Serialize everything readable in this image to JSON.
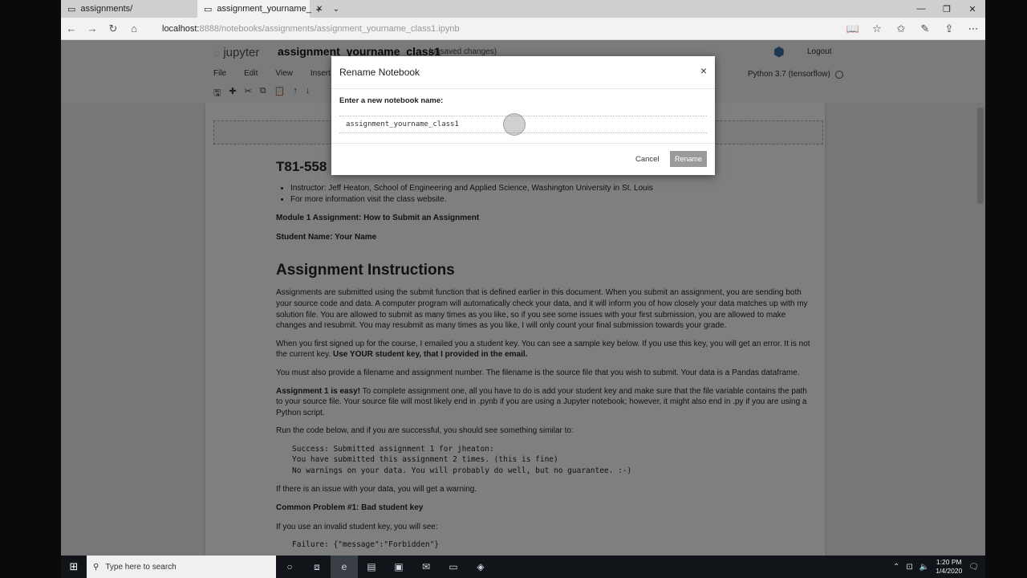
{
  "browser": {
    "tabs": [
      {
        "title": "assignments/",
        "active": false
      },
      {
        "title": "assignment_yourname_",
        "active": true
      }
    ],
    "new_tab": "+",
    "tab_menu": "⌄",
    "url_host": "localhost:",
    "url_rest": "8888/notebooks/assignments/assignment_yourname_class1.ipynb"
  },
  "jupyter": {
    "logo_text": "jupyter",
    "notebook_title": "assignment_yourname_class1",
    "save_status": "(unsaved changes)",
    "logout_label": "Logout",
    "menu": [
      "File",
      "Edit",
      "View",
      "Insert"
    ],
    "kernel_label": "Python 3.7 (tensorflow)",
    "toolbar_icons": [
      "save-icon",
      "plus-icon",
      "cut-icon",
      "copy-icon",
      "paste-icon",
      "arrow-up-icon",
      "arrow-down-icon"
    ]
  },
  "notebook": {
    "course_title": "T81-558",
    "bullets": [
      "Instructor: Jeff Heaton, School of Engineering and Applied Science, Washington University in St. Louis",
      "For more information visit the class website."
    ],
    "module_line": "Module 1 Assignment: How to Submit an Assignment",
    "student_line": "Student Name: Your Name",
    "h2": "Assignment Instructions",
    "p1": "Assignments are submitted using the submit function that is defined earlier in this document. When you submit an assignment, you are sending both your source code and data. A computer program will automatically check your data, and it will inform you of how closely your data matches up with my solution file. You are allowed to submit as many times as you like, so if you see some issues with your first submission, you are allowed to make changes and resubmit. You may resubmit as many times as you like, I will only count your final submission towards your grade.",
    "p2_a": "When you first signed up for the course, I emailed you a student key. You can see a sample key below. If you use this key, you will get an error. It is not the current key. ",
    "p2_b": "Use YOUR student key, that I provided in the email.",
    "p3": "You must also provide a filename and assignment number. The filename is the source file that you wish to submit. Your data is a Pandas dataframe.",
    "p4_a": "Assignment 1 is easy!",
    "p4_b": " To complete assignment one, all you have to do is add your student key and make sure that the file variable contains the path to your source file. Your source file will most likely end in .pynb if you are using a Jupyter notebook; however, it might also end in .py if you are using a Python script.",
    "p5": "Run the code below, and if you are successful, you should see something similar to:",
    "code1": "Success: Submitted assignment 1 for jheaton:\nYou have submitted this assignment 2 times. (this is fine)\nNo warnings on your data. You will probably do well, but no guarantee. :-)",
    "p6": "If there is an issue with your data, you will get a warning.",
    "problem1": "Common Problem #1: Bad student key",
    "p7": "If you use an invalid student key, you will see:",
    "code2": "Failure: {\"message\":\"Forbidden\"}"
  },
  "dialog": {
    "title": "Rename Notebook",
    "close": "×",
    "label": "Enter a new notebook name:",
    "input_value": "assignment_yourname_class1",
    "cancel_label": "Cancel",
    "rename_label": "Rename"
  },
  "taskbar": {
    "search_placeholder": "Type here to search",
    "time": "1:20 PM",
    "date": "1/4/2020"
  }
}
